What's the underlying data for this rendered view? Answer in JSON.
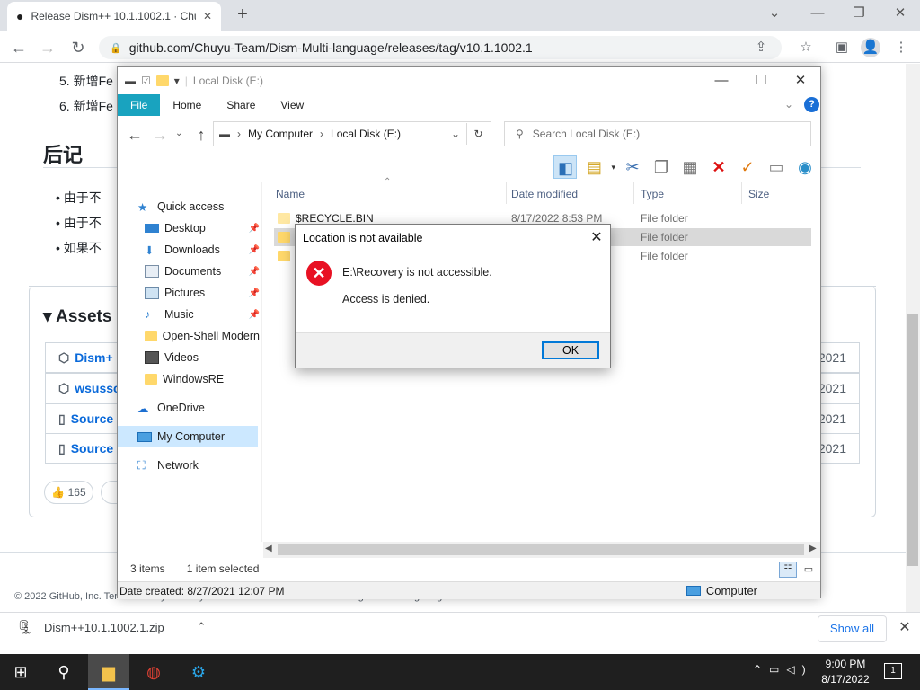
{
  "browser": {
    "tab_title": "Release Dism++ 10.1.1002.1 · Chuyu",
    "url": "github.com/Chuyu-Team/Dism-Multi-language/releases/tag/v10.1.1002.1"
  },
  "page": {
    "list_items": [
      "5. 新增Fe",
      "6. 新增Fe"
    ],
    "afterword_heading": "后记",
    "bullets": [
      "由于不",
      "由于不",
      "如果不"
    ],
    "assets_heading": "Assets",
    "assets": [
      {
        "name": "Dism+",
        "date": "2021"
      },
      {
        "name": "wsussc",
        "date": "2021"
      },
      {
        "name": "Source",
        "date": "2021"
      },
      {
        "name": "Source",
        "date": "2021"
      }
    ],
    "reaction_count": "165",
    "footer_text": "© 2022 GitHub, Inc.   Terms   Privacy   Security   Status   Docs   Contact GitHub   Pricing   API   Training   Blog   About"
  },
  "explorer": {
    "title": "Local Disk (E:)",
    "ribbon_tabs": [
      "File",
      "Home",
      "Share",
      "View"
    ],
    "path": [
      "My Computer",
      "Local Disk (E:)"
    ],
    "search_placeholder": "Search Local Disk (E:)",
    "sidebar": [
      {
        "label": "Quick access",
        "icon": "star-icon"
      },
      {
        "label": "Desktop",
        "icon": "desktop-icon"
      },
      {
        "label": "Downloads",
        "icon": "download-icon"
      },
      {
        "label": "Documents",
        "icon": "documents-icon"
      },
      {
        "label": "Pictures",
        "icon": "pictures-icon"
      },
      {
        "label": "Music",
        "icon": "music-icon"
      },
      {
        "label": "Open-Shell Modern",
        "icon": "folder-icon"
      },
      {
        "label": "Videos",
        "icon": "videos-icon"
      },
      {
        "label": "WindowsRE",
        "icon": "folder-icon"
      },
      {
        "label": "OneDrive",
        "icon": "cloud-icon"
      },
      {
        "label": "My Computer",
        "icon": "computer-icon"
      },
      {
        "label": "Network",
        "icon": "network-icon"
      }
    ],
    "columns": [
      "Name",
      "Date modified",
      "Type",
      "Size"
    ],
    "files": [
      {
        "name": "$RECYCLE.BIN",
        "date": "8/17/2022 8:53 PM",
        "type": "File folder"
      },
      {
        "name": "",
        "date": "",
        "type": "File folder"
      },
      {
        "name": "",
        "date": "",
        "type": "File folder"
      }
    ],
    "status_items": "3 items",
    "status_selected": "1 item selected",
    "details_date": "Date created: 8/27/2021 12:07 PM",
    "details_location": "Computer"
  },
  "dialog": {
    "title": "Location is not available",
    "message1": "E:\\Recovery is not accessible.",
    "message2": "Access is denied.",
    "ok_label": "OK"
  },
  "downloads": {
    "file": "Dism++10.1.1002.1.zip",
    "show_all": "Show all"
  },
  "taskbar": {
    "time": "9:00 PM",
    "date": "8/17/2022",
    "notification_count": "1"
  }
}
